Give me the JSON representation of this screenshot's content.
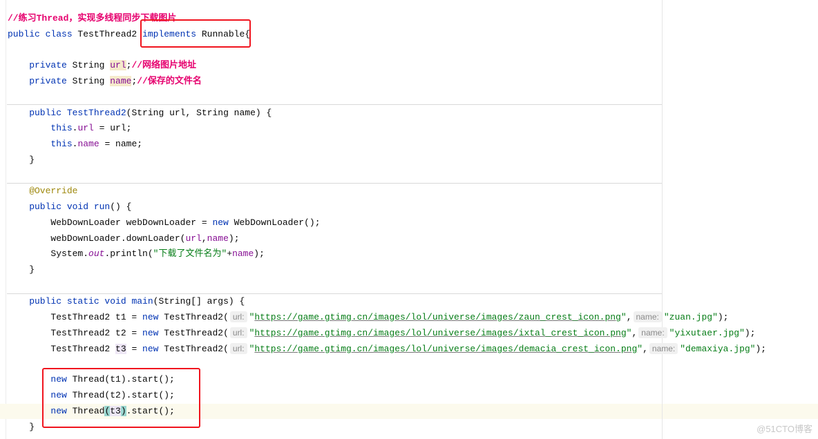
{
  "editor": {
    "lines": [
      [
        [
          "//练习Thread，实现多线程同步下载图片",
          "cm"
        ]
      ],
      [
        [
          "public class ",
          "kw"
        ],
        [
          "TestThread2 ",
          ""
        ],
        [
          "implements ",
          "kw"
        ],
        [
          "Runnable{",
          ""
        ]
      ],
      [],
      [
        [
          "    private ",
          "kw"
        ],
        [
          "String ",
          ""
        ],
        [
          "url",
          "fd hl"
        ],
        [
          ";",
          ""
        ],
        [
          "//网络图片地址",
          "cm"
        ]
      ],
      [
        [
          "    private ",
          "kw"
        ],
        [
          "String ",
          ""
        ],
        [
          "name",
          "fd hl"
        ],
        [
          ";",
          ""
        ],
        [
          "//保存的文件名",
          "cm"
        ]
      ],
      [],
      [
        [
          "    public ",
          "kw"
        ],
        [
          "TestThread2",
          "kw"
        ],
        [
          "(String url, String name) {",
          ""
        ]
      ],
      [
        [
          "        this",
          "kw"
        ],
        [
          ".",
          ""
        ],
        [
          "url",
          "fd"
        ],
        [
          " = url;",
          ""
        ]
      ],
      [
        [
          "        this",
          "kw"
        ],
        [
          ".",
          ""
        ],
        [
          "name",
          "fd"
        ],
        [
          " = name;",
          ""
        ]
      ],
      [
        [
          "    }",
          ""
        ]
      ],
      [],
      [
        [
          "    @Override",
          "an"
        ]
      ],
      [
        [
          "    public void ",
          "kw"
        ],
        [
          "run",
          "kw"
        ],
        [
          "() {",
          ""
        ]
      ],
      [
        [
          "        WebDownLoader webDownLoader = ",
          ""
        ],
        [
          "new ",
          "kw"
        ],
        [
          "WebDownLoader();",
          ""
        ]
      ],
      [
        [
          "        webDownLoader.downLoader(",
          ""
        ],
        [
          "url",
          "fd"
        ],
        [
          ",",
          ""
        ],
        [
          "name",
          "fd"
        ],
        [
          ");",
          ""
        ]
      ],
      [
        [
          "        System.",
          ""
        ],
        [
          "out",
          "it"
        ],
        [
          ".println(",
          ""
        ],
        [
          "\"下载了文件名为\"",
          "st"
        ],
        [
          "+",
          ""
        ],
        [
          "name",
          "fd"
        ],
        [
          ");",
          ""
        ]
      ],
      [
        [
          "    }",
          ""
        ]
      ],
      [],
      [
        [
          "    public static void ",
          "kw"
        ],
        [
          "main",
          "kw"
        ],
        [
          "(String[] args) {",
          ""
        ]
      ],
      [
        [
          "        TestThread2 t1 = ",
          ""
        ],
        [
          "new ",
          "kw"
        ],
        [
          "TestThread2(",
          ""
        ],
        [
          "url:",
          "hint"
        ],
        [
          "\"",
          "st"
        ],
        [
          "https://game.gtimg.cn/images/lol/universe/images/zaun_crest_icon.png",
          "url"
        ],
        [
          "\"",
          "st"
        ],
        [
          ",",
          ""
        ],
        [
          "name:",
          "hint"
        ],
        [
          "\"zuan.jpg\"",
          "st"
        ],
        [
          ");",
          ""
        ]
      ],
      [
        [
          "        TestThread2 t2 = ",
          ""
        ],
        [
          "new ",
          "kw"
        ],
        [
          "TestThread2(",
          ""
        ],
        [
          "url:",
          "hint"
        ],
        [
          "\"",
          "st"
        ],
        [
          "https://game.gtimg.cn/images/lol/universe/images/ixtal_crest_icon.png",
          "url"
        ],
        [
          "\"",
          "st"
        ],
        [
          ",",
          ""
        ],
        [
          "name:",
          "hint"
        ],
        [
          "\"yixutaer.jpg\"",
          "st"
        ],
        [
          ");",
          ""
        ]
      ],
      [
        [
          "        TestThread2 ",
          ""
        ],
        [
          "t3",
          "hv"
        ],
        [
          " = ",
          ""
        ],
        [
          "new ",
          "kw"
        ],
        [
          "TestThread2(",
          ""
        ],
        [
          "url:",
          "hint"
        ],
        [
          "\"",
          "st"
        ],
        [
          "https://game.gtimg.cn/images/lol/universe/images/demacia_crest_icon.png",
          "url"
        ],
        [
          "\"",
          "st"
        ],
        [
          ",",
          ""
        ],
        [
          "name:",
          "hint"
        ],
        [
          "\"demaxiya.jpg\"",
          "st"
        ],
        [
          ");",
          ""
        ]
      ],
      [],
      [
        [
          "        new ",
          "kw"
        ],
        [
          "Thread(t1).start();",
          ""
        ]
      ],
      [
        [
          "        new ",
          "kw"
        ],
        [
          "Thread(t2).start();",
          ""
        ]
      ],
      [
        [
          "        new ",
          "kw"
        ],
        [
          "Thread",
          ""
        ],
        [
          "(",
          "br"
        ],
        [
          "t3",
          "hv"
        ],
        [
          ")",
          "br"
        ],
        [
          ".start();",
          ""
        ]
      ],
      [
        [
          "    }",
          ""
        ]
      ]
    ]
  },
  "colors": {
    "highlight_box": "#f0141e",
    "keyword": "#0033b3",
    "comment": "#e6006e",
    "string": "#067d17",
    "field": "#871094"
  },
  "watermark": "@51CTO博客"
}
